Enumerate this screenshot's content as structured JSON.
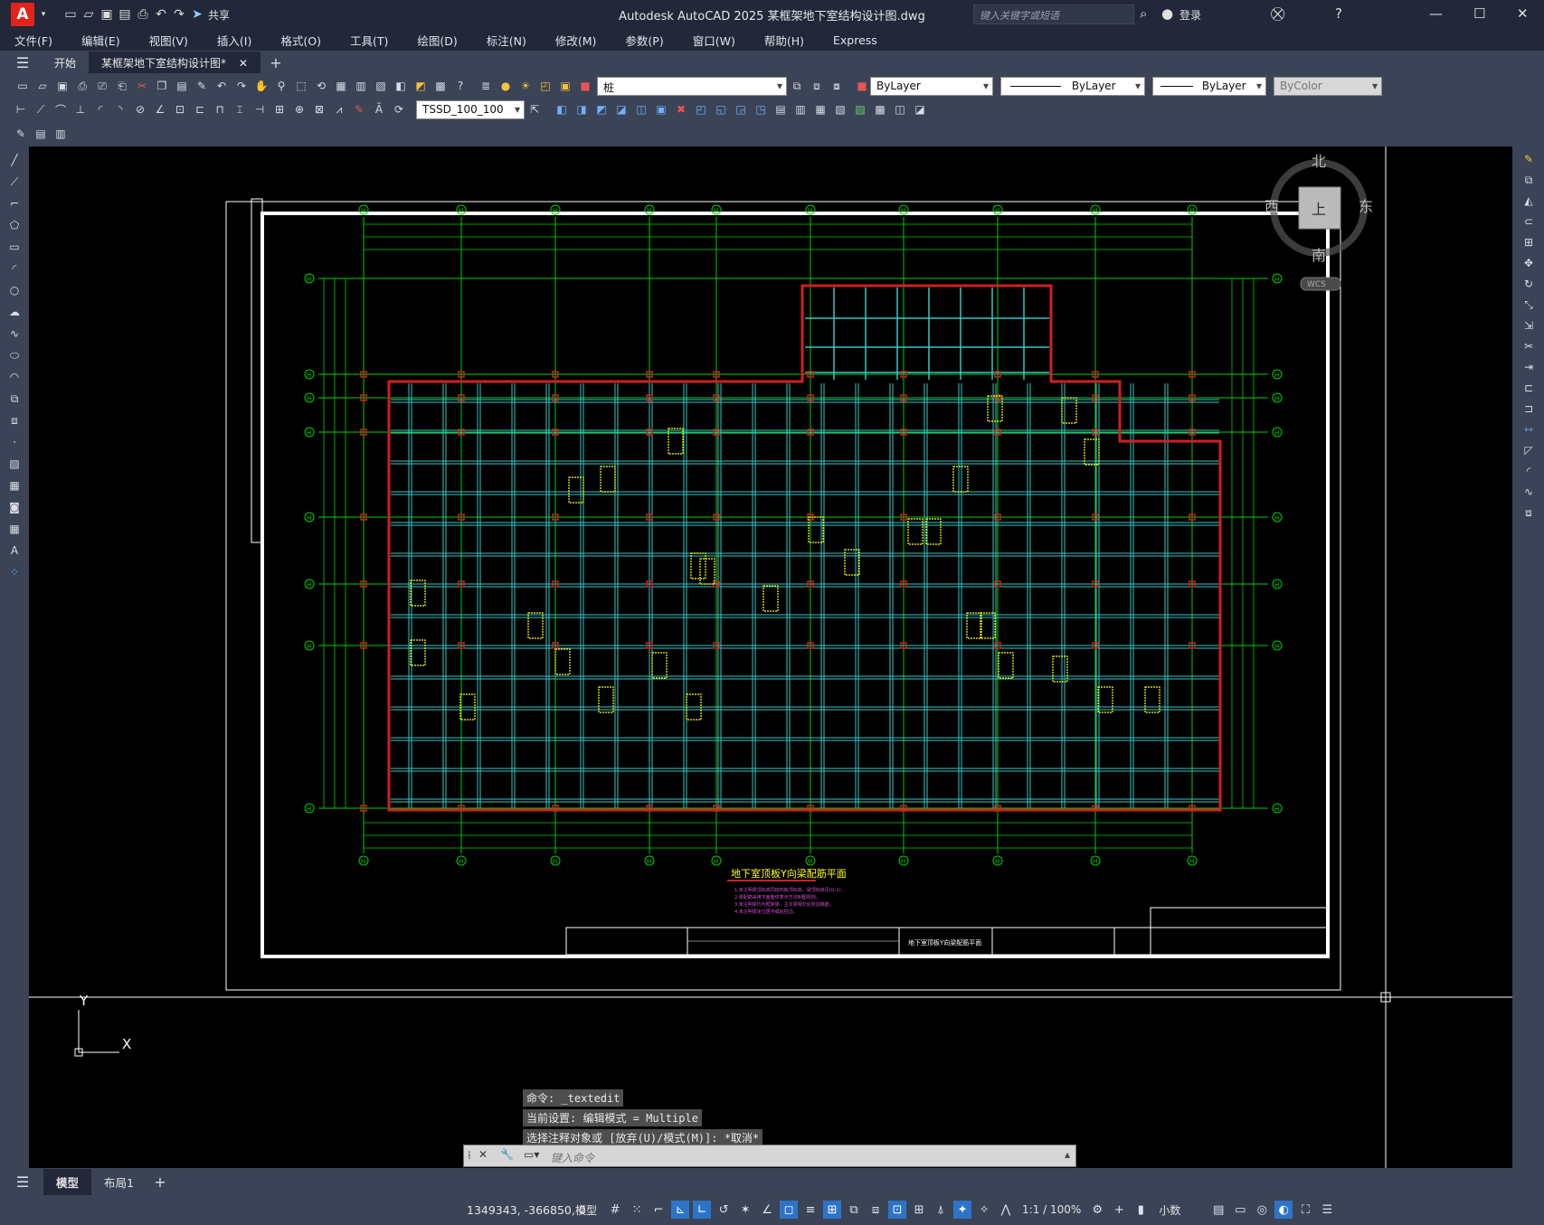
{
  "app": {
    "title": "Autodesk AutoCAD 2025    某框架地下室结构设计图.dwg",
    "share": "共享",
    "search_placeholder": "键入关键字或短语",
    "login": "登录"
  },
  "menu": [
    "文件(F)",
    "编辑(E)",
    "视图(V)",
    "插入(I)",
    "格式(O)",
    "工具(T)",
    "绘图(D)",
    "标注(N)",
    "修改(M)",
    "参数(P)",
    "窗口(W)",
    "帮助(H)",
    "Express"
  ],
  "tabs": {
    "start": "开始",
    "doc": "某框架地下室结构设计图*"
  },
  "toolbar": {
    "layer": "桩",
    "color": "ByLayer",
    "linetype": "ByLayer",
    "lineweight": "ByLayer",
    "plotstyle": "ByColor",
    "dimstyle": "TSSD_100_100"
  },
  "viewcube": {
    "north": "北",
    "south": "南",
    "east": "东",
    "west": "西",
    "top": "上",
    "wcs": "WCS"
  },
  "ucs": {
    "x": "X",
    "y": "Y"
  },
  "drawing": {
    "title": "地下室顶板Y向梁配筋平面",
    "notes": [
      "1.未注明梁顶标高同结构板顶标高，梁顶标高见(G-1)...",
      "2.梁配筋采用平面整体表示方法制图规则。",
      "3.未注明梁均为框架梁，主次梁相交处附加箍筋。",
      "4.未注明梁定位居中或贴柱边。"
    ],
    "axis_labels": [
      "H",
      "H",
      "H",
      "H",
      "H",
      "H",
      "H",
      "H",
      "H",
      "H"
    ],
    "row_labels": [
      "H",
      "H",
      "H",
      "H",
      "H",
      "H",
      "H",
      "H",
      "H"
    ],
    "tb_title": "地下室顶板Y向梁配筋平面"
  },
  "command": {
    "history": [
      "命令: _textedit",
      "当前设置: 编辑模式 = Multiple",
      "选择注释对象或 [放弃(U)/模式(M)]: *取消*"
    ],
    "placeholder": "键入命令"
  },
  "layouts": {
    "model": "模型",
    "layout1": "布局1"
  },
  "status": {
    "coords": "1349343, -366850, 0",
    "model": "模型",
    "scale": "1:1 / 100%",
    "units": "小数"
  },
  "colors": {
    "grid": "#00d000",
    "beam": "#37c6c6",
    "wall": "#d02020",
    "label": "#ffff00"
  }
}
